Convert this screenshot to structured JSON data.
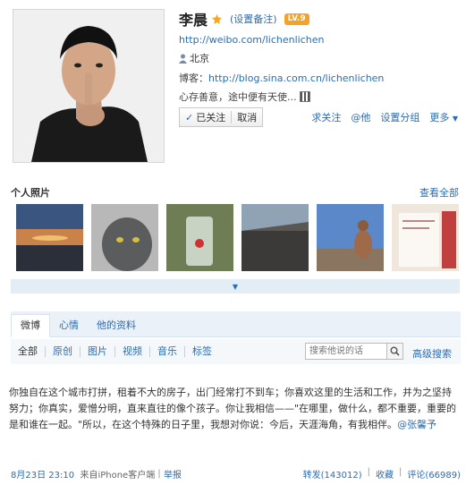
{
  "profile": {
    "name": "李晨",
    "set_remark": "(设置备注)",
    "level": "LV.9",
    "weibo_url": "http://weibo.com/lichenlichen",
    "location": "北京",
    "blog_label": "博客：",
    "blog_url": "http://blog.sina.com.cn/lichenlichen",
    "motto": "心存善意，途中便有天使..."
  },
  "follow": {
    "check": "✓",
    "label": "已关注",
    "cancel": "取消"
  },
  "actions": {
    "follow_tweet": "求关注",
    "at": "@他",
    "group": "设置分组",
    "more": "更多",
    "more_caret": "▼"
  },
  "photos": {
    "title": "个人照片",
    "see_all": "查看全部",
    "expand": "▼"
  },
  "tabs": [
    "微博",
    "心情",
    "他的资料"
  ],
  "filters": [
    "全部",
    "原创",
    "图片",
    "视频",
    "音乐",
    "标签"
  ],
  "search": {
    "placeholder": "搜索他说的话",
    "advanced": "高级搜索"
  },
  "post": {
    "text": "你独自在这个城市打拼，租着不大的房子，出门经常打不到车；你喜欢这里的生活和工作，并为之坚持努力；你真实，爱憎分明，直来直往的像个孩子。你让我相信——\"在哪里，做什么，都不重要，重要的是和谁在一起。\"所以，在这个特殊的日子里，我想对你说：今后，天涯海角，有我相伴。",
    "mention": "@张馨予",
    "time": "8月23日 23:10",
    "source": "来自iPhone客户端",
    "report": "举报",
    "forward": "转发(143012)",
    "favorite": "收藏",
    "comment": "评论(66989)"
  },
  "colors": {
    "link": "#2a6db3",
    "level_badge": "#f3a22a",
    "tab_bg": "#eaf1f8"
  }
}
